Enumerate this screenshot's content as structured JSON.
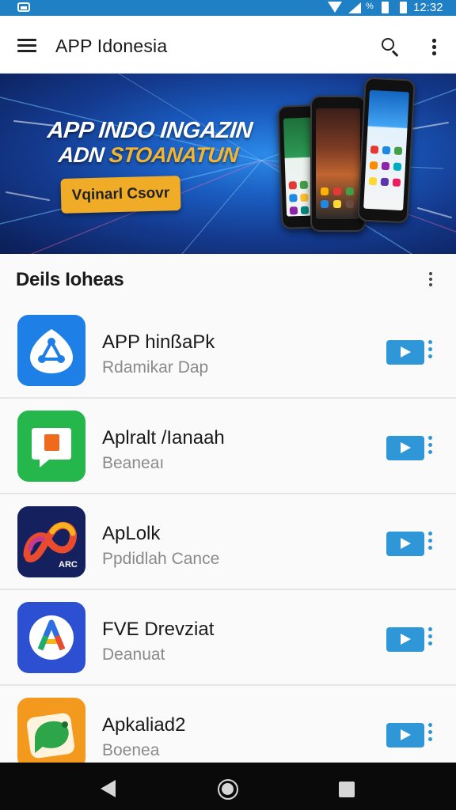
{
  "status_bar": {
    "battery_percent_label": "%",
    "time": "12:32"
  },
  "app_bar": {
    "title": "APP Idonesia"
  },
  "banner": {
    "headline_line1": "APP INDO INGAZIN",
    "headline_line2_prefix": "ADN ",
    "headline_line2_accent": "STOANATUN",
    "cta_label": "Vqinarl Csovr"
  },
  "section": {
    "title": "Deils Iohеas"
  },
  "apps": [
    {
      "name": "APP hinßaPk",
      "subtitle": "Rdamikar Dap",
      "icon": "dots-triangle-app-icon",
      "icon_color": "#1e7fe6"
    },
    {
      "name": "Aplralt /Ianaah",
      "subtitle": "Beaneaı",
      "icon": "chat-bubble-app-icon",
      "icon_color": "#25b74b"
    },
    {
      "name": "ApLolk",
      "subtitle": "Ppdidlah Cance",
      "icon": "infinity-swirl-app-icon",
      "icon_color": "#15205f",
      "icon_text": "ARC"
    },
    {
      "name": "FVE Drevziat",
      "subtitle": "Deanuat",
      "icon": "letter-a-app-icon",
      "icon_color": "#2d4fd2"
    },
    {
      "name": "Apkaliad2",
      "subtitle": "Boenea",
      "icon": "green-bubble-app-icon",
      "icon_color": "#f39a1e"
    }
  ],
  "colors": {
    "status_bar": "#1f80c5",
    "accent": "#2f96d8",
    "banner_cta": "#f0ac27"
  }
}
